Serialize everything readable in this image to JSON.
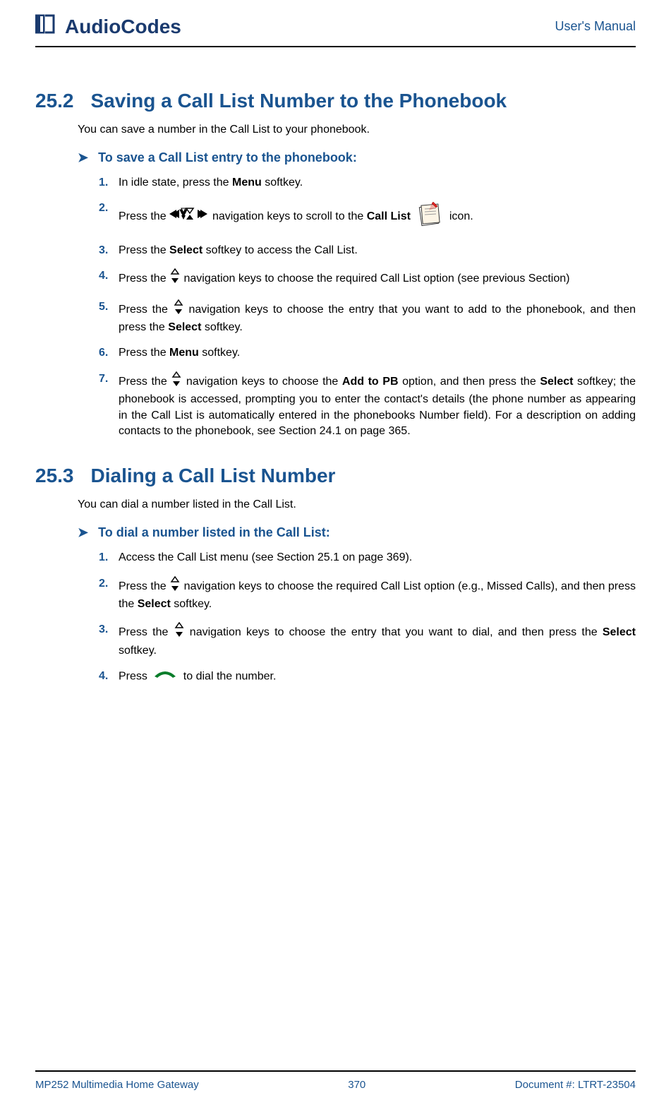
{
  "header": {
    "logo_text": "AudioCodes",
    "right_text": "User's Manual"
  },
  "section252": {
    "number": "25.2",
    "title": "Saving a Call List Number to the Phonebook",
    "intro": "You can save a number in the Call List to your phonebook.",
    "procedure_title": "To save a Call List entry to the phonebook:",
    "steps": {
      "s1": {
        "num": "1.",
        "text_before": "In idle state, press the ",
        "bold1": "Menu",
        "text_after": " softkey."
      },
      "s2": {
        "num": "2.",
        "text_before": "Press the ",
        "text_mid": " navigation keys to scroll to the ",
        "bold1": "Call List",
        "text_after": " icon."
      },
      "s3": {
        "num": "3.",
        "text_before": "Press the ",
        "bold1": "Select",
        "text_after": " softkey to access the Call List."
      },
      "s4": {
        "num": "4.",
        "text_before": "Press the ",
        "text_after": " navigation keys to choose the required Call List option (see previous Section)"
      },
      "s5": {
        "num": "5.",
        "text_before": "Press the ",
        "text_mid": " navigation keys to choose the entry that you want to add to the phonebook, and then press the ",
        "bold1": "Select",
        "text_after": " softkey."
      },
      "s6": {
        "num": "6.",
        "text_before": "Press the ",
        "bold1": "Menu",
        "text_after": " softkey."
      },
      "s7": {
        "num": "7.",
        "text_before": "Press the ",
        "text_mid": " navigation keys to choose the ",
        "bold1": "Add to PB",
        "text_mid2": " option, and then press the ",
        "bold2": "Select",
        "text_after": " softkey; the phonebook is accessed, prompting you to enter the contact's details (the phone number as appearing in the Call List is automatically entered in the phonebooks Number field). For a description on adding contacts to the phonebook, see Section 24.1 on page 365."
      }
    }
  },
  "section253": {
    "number": "25.3",
    "title": "Dialing a Call List Number",
    "intro": "You can dial a number listed in the Call List.",
    "procedure_title": "To dial a number listed in the Call List:",
    "steps": {
      "s1": {
        "num": "1.",
        "text": "Access the Call List menu (see Section 25.1 on page 369)."
      },
      "s2": {
        "num": "2.",
        "text_before": "Press the ",
        "text_mid": " navigation keys to choose the required Call List option (e.g., Missed Calls), and then press the ",
        "bold1": "Select",
        "text_after": " softkey."
      },
      "s3": {
        "num": "3.",
        "text_before": "Press the ",
        "text_mid": " navigation keys to choose the entry that you want to dial, and then press the ",
        "bold1": "Select",
        "text_after": " softkey."
      },
      "s4": {
        "num": "4.",
        "text_before": "Press ",
        "text_after": " to dial the number."
      }
    }
  },
  "footer": {
    "left": "MP252 Multimedia Home Gateway",
    "center": "370",
    "right": "Document #: LTRT-23504"
  }
}
